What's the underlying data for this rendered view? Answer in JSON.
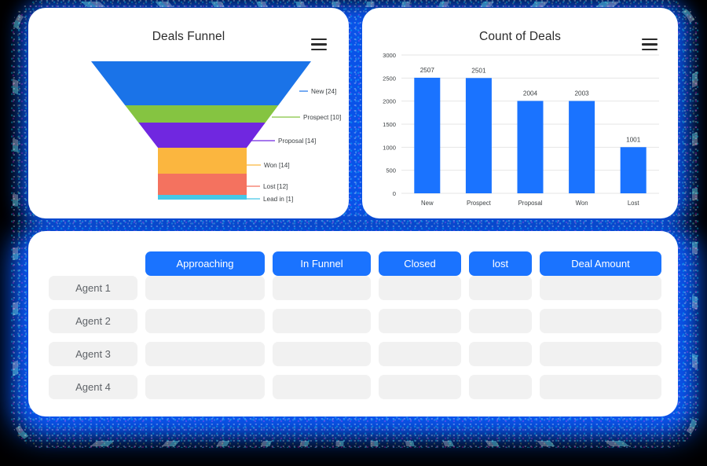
{
  "chart_data": [
    {
      "type": "funnel",
      "title": "Deals Funnel",
      "categories": [
        "New",
        "Prospect",
        "Proposal",
        "Won",
        "Lost",
        "Lead in"
      ],
      "values": [
        24,
        10,
        14,
        14,
        12,
        1
      ],
      "labels": [
        "New [24]",
        "Prospect [10]",
        "Proposal [14]",
        "Won [14]",
        "Lost [12]",
        "Lead in [1]"
      ],
      "colors": [
        "#1a73e8",
        "#85c441",
        "#7027e0",
        "#fbb63f",
        "#f4725f",
        "#45c8e8"
      ],
      "legend": "right-callout",
      "grid": false
    },
    {
      "type": "bar",
      "title": "Count of Deals",
      "categories": [
        "New",
        "Prospect",
        "Proposal",
        "Won",
        "Lost"
      ],
      "values": [
        2507,
        2501,
        2004,
        2003,
        1001
      ],
      "value_labels": [
        "2507",
        "2501",
        "2004",
        "2003",
        "1001"
      ],
      "yticks": [
        0,
        500,
        1000,
        1500,
        2000,
        2500,
        3000
      ],
      "ytick_labels": [
        "0",
        "500",
        "1000",
        "1500",
        "2000",
        "2500",
        "3000"
      ],
      "ylim": [
        0,
        3000
      ],
      "xlabel": "",
      "ylabel": "",
      "bar_color": "#1a73ff",
      "grid": true,
      "legend": "none"
    }
  ],
  "funnel_card": {
    "title": "Deals Funnel",
    "menu_icon": "hamburger-menu-icon"
  },
  "bars_card": {
    "title": "Count of Deals",
    "menu_icon": "hamburger-menu-icon"
  },
  "table_card": {
    "columns": [
      "Approaching",
      "In Funnel",
      "Closed",
      "lost",
      "Deal Amount"
    ],
    "rows": [
      {
        "label": "Agent 1",
        "cells": [
          "",
          "",
          "",
          "",
          ""
        ]
      },
      {
        "label": "Agent 2",
        "cells": [
          "",
          "",
          "",
          "",
          ""
        ]
      },
      {
        "label": "Agent 3",
        "cells": [
          "",
          "",
          "",
          "",
          ""
        ]
      },
      {
        "label": "Agent 4",
        "cells": [
          "",
          "",
          "",
          "",
          ""
        ]
      }
    ]
  },
  "theme": {
    "accent": "#1a73ff",
    "background": "#000000",
    "glow": "#0a55f0",
    "card": "#ffffff",
    "cell": "#f1f1f1"
  }
}
